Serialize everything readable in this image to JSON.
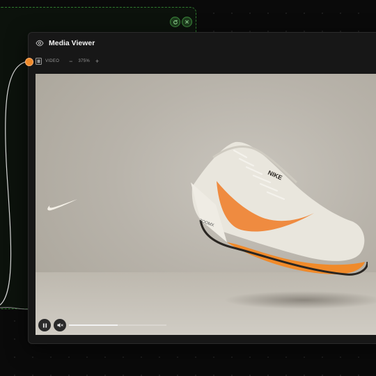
{
  "viewer": {
    "title": "Media Viewer",
    "eye_icon": "eye-icon",
    "toolbar": {
      "type_icon": "film-icon",
      "type_label": "VIDEO",
      "zoom_out": "−",
      "zoom": "375%",
      "zoom_in": "+"
    },
    "media": {
      "subject": "nike-running-shoe",
      "playback_progress": 0.5
    },
    "controls": {
      "pause_icon": "pause-icon",
      "mute_icon": "mute-icon"
    }
  },
  "back_panel": {
    "icons": [
      "refresh-icon",
      "close-icon"
    ]
  },
  "colors": {
    "accent_orange": "#f08a2a",
    "node_green": "#2f7a2f",
    "panel_bg": "#171717"
  }
}
